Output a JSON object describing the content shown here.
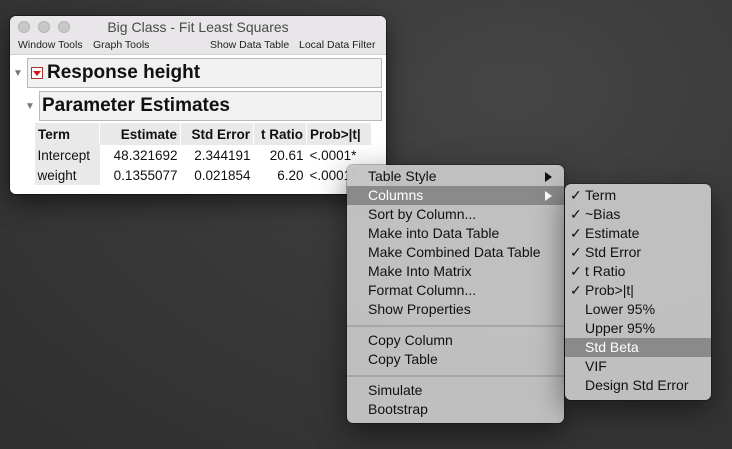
{
  "window": {
    "title": "Big Class - Fit Least Squares",
    "toolbar": {
      "window_tools": "Window Tools",
      "graph_tools": "Graph Tools",
      "show_data_table": "Show Data Table",
      "local_data_filter": "Local Data Filter"
    },
    "response_title": "Response height",
    "section_title": "Parameter Estimates",
    "table": {
      "headers": [
        "Term",
        "Estimate",
        "Std Error",
        "t Ratio",
        "Prob>|t|"
      ],
      "rows": [
        [
          "Intercept",
          "48.321692",
          "2.344191",
          "20.61",
          "<.0001*"
        ],
        [
          "weight",
          "0.1355077",
          "0.021854",
          "6.20",
          "<.0001*"
        ]
      ]
    }
  },
  "context_menu": {
    "items": [
      {
        "label": "Table Style",
        "submenu": true
      },
      {
        "label": "Columns",
        "submenu": true,
        "highlighted": true
      },
      {
        "label": "Sort by Column..."
      },
      {
        "label": "Make into Data Table"
      },
      {
        "label": "Make Combined Data Table"
      },
      {
        "label": "Make Into Matrix"
      },
      {
        "label": "Format Column..."
      },
      {
        "label": "Show Properties"
      },
      {
        "label": "Copy Column"
      },
      {
        "label": "Copy Table"
      },
      {
        "label": "Simulate"
      },
      {
        "label": "Bootstrap"
      }
    ]
  },
  "columns_submenu": {
    "items": [
      {
        "label": "Term",
        "checked": true
      },
      {
        "label": "~Bias",
        "checked": true
      },
      {
        "label": "Estimate",
        "checked": true
      },
      {
        "label": "Std Error",
        "checked": true
      },
      {
        "label": "t Ratio",
        "checked": true
      },
      {
        "label": "Prob>|t|",
        "checked": true
      },
      {
        "label": "Lower 95%",
        "checked": false
      },
      {
        "label": "Upper 95%",
        "checked": false
      },
      {
        "label": "Std Beta",
        "checked": false,
        "highlighted": true
      },
      {
        "label": "VIF",
        "checked": false
      },
      {
        "label": "Design Std Error",
        "checked": false
      }
    ],
    "check_glyph": "✓"
  },
  "colors": {
    "pvalue": "#e0692a",
    "highlight": "#8a8a8a",
    "menu_bg": "#c4c4c4"
  }
}
